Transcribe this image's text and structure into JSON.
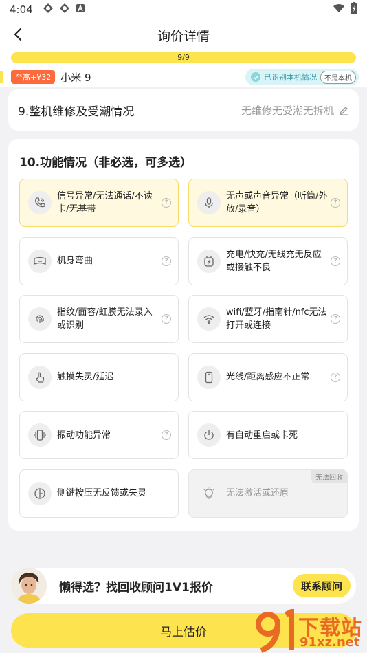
{
  "status_bar": {
    "time": "4:04"
  },
  "nav": {
    "title": "询价详情"
  },
  "progress": {
    "text": "9/9",
    "fraction": 1.0
  },
  "device": {
    "price_tag": "至高+¥32",
    "model": "小米 9",
    "recognized_label": "已识别本机情况",
    "not_mine_label": "不是本机"
  },
  "section9": {
    "question": "9.整机维修及受潮情况",
    "answer": "无维修无受潮无拆机"
  },
  "section10": {
    "heading": "10.功能情况（非必选，可多选）",
    "options": [
      {
        "label": "信号异常/无法通话/不读卡/无基带",
        "icon": "phone-call-icon",
        "selected": true,
        "help": "?"
      },
      {
        "label": "无声或声音异常（听筒/外放/录音）",
        "icon": "microphone-icon",
        "selected": true,
        "help": "?"
      },
      {
        "label": "机身弯曲",
        "icon": "bent-phone-icon",
        "selected": false,
        "help": "?"
      },
      {
        "label": "充电/快充/无线充无反应或接触不良",
        "icon": "charging-icon",
        "selected": false,
        "help": "?"
      },
      {
        "label": "指纹/面容/虹膜无法录入或识别",
        "icon": "fingerprint-icon",
        "selected": false,
        "help": "?"
      },
      {
        "label": "wifi/蓝牙/指南针/nfc无法打开或连接",
        "icon": "wifi-icon",
        "selected": false,
        "help": "?"
      },
      {
        "label": "触摸失灵/延迟",
        "icon": "touch-hand-icon",
        "selected": false,
        "help": ""
      },
      {
        "label": "光线/距离感应不正常",
        "icon": "sensor-phone-icon",
        "selected": false,
        "help": "?"
      },
      {
        "label": "振动功能异常",
        "icon": "vibration-icon",
        "selected": false,
        "help": "?"
      },
      {
        "label": "有自动重启或卡死",
        "icon": "power-icon",
        "selected": false,
        "help": ""
      },
      {
        "label": "侧键按压无反馈或失灵",
        "icon": "side-button-icon",
        "selected": false,
        "help": ""
      },
      {
        "label": "无法激活或还原",
        "icon": "lightbulb-icon",
        "selected": false,
        "disabled": true,
        "badge": "无法回收",
        "help": ""
      }
    ]
  },
  "advisor": {
    "text": "懒得选？找回收顾问1V1报价",
    "button": "联系顾问"
  },
  "main_button": "马上估价",
  "watermark": {
    "line1": "下载站",
    "line2": "91xz.net",
    "logo": "91"
  },
  "colors": {
    "accent": "#fde34d",
    "price_tag": "#ff6a3d",
    "recognized_bg": "#d8f4f6",
    "watermark": "#e86a24"
  }
}
